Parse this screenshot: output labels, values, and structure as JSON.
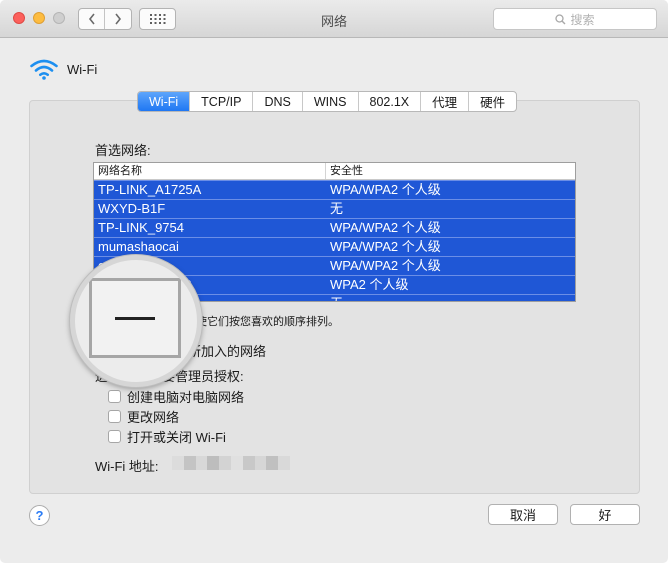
{
  "window": {
    "title": "网络",
    "search_placeholder": "搜索"
  },
  "header": {
    "service_name": "Wi-Fi"
  },
  "tabs": [
    {
      "label": "Wi-Fi",
      "active": true
    },
    {
      "label": "TCP/IP",
      "active": false
    },
    {
      "label": "DNS",
      "active": false
    },
    {
      "label": "WINS",
      "active": false
    },
    {
      "label": "802.1X",
      "active": false
    },
    {
      "label": "代理",
      "active": false
    },
    {
      "label": "硬件",
      "active": false
    }
  ],
  "preferred": {
    "label": "首选网络:",
    "columns": [
      "网络名称",
      "安全性"
    ],
    "rows": [
      {
        "name": "TP-LINK_A1725A",
        "security": "WPA/WPA2 个人级"
      },
      {
        "name": "WXYD-B1F",
        "security": "无"
      },
      {
        "name": "TP-LINK_9754",
        "security": "WPA/WPA2 个人级"
      },
      {
        "name": "mumashaocai",
        "security": "WPA/WPA2 个人级"
      },
      {
        "name": "c",
        "security": "WPA/WPA2 个人级"
      },
      {
        "name": "?",
        "security": "WPA2 个人级"
      },
      {
        "name": "",
        "security": "无"
      }
    ],
    "hint": "使它们按您喜欢的顺序排列。"
  },
  "options": {
    "remember_label": "所加入的网络",
    "admin_label": "进",
    "admin_label_tail": "需要管理员授权:",
    "checkboxes": [
      {
        "label": "创建电脑对电脑网络",
        "checked": false
      },
      {
        "label": "更改网络",
        "checked": false
      },
      {
        "label": "打开或关闭 Wi-Fi",
        "checked": false
      }
    ]
  },
  "address": {
    "label": "Wi-Fi 地址:"
  },
  "buttons": {
    "help": "?",
    "cancel": "取消",
    "ok": "好"
  },
  "colors": {
    "accent": "#1f77f3",
    "selection": "#1f57d6"
  }
}
